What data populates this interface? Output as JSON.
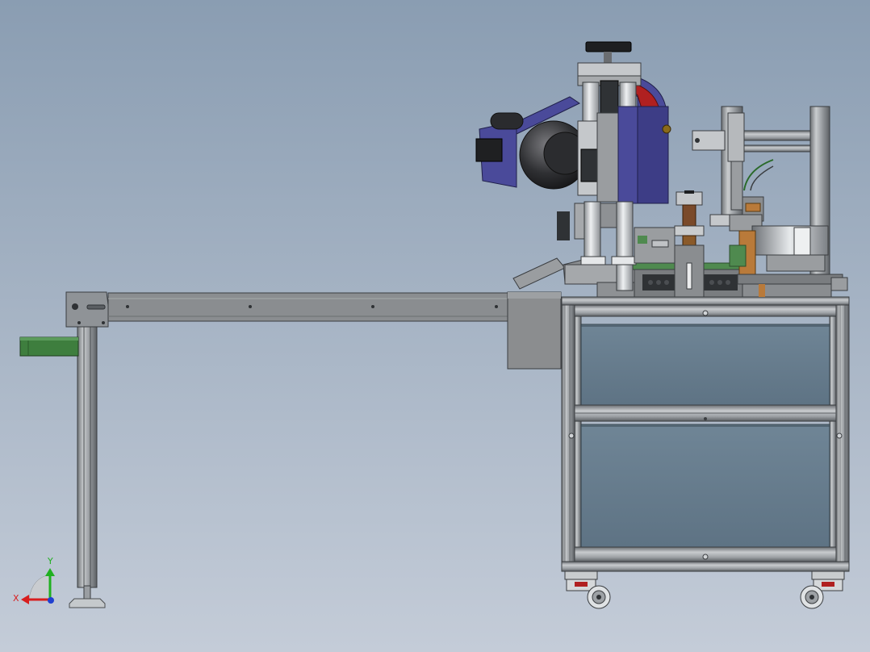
{
  "viewport": {
    "background_top": "#8a9db2",
    "background_bottom": "#c4ccd8"
  },
  "triad": {
    "x_label": "X",
    "y_label": "Y",
    "x_color": "#d81e1e",
    "y_color": "#20b020",
    "z_color": "#2040d0"
  },
  "model": {
    "frame_color": "#a8acb0",
    "panel_color": "#647b8c",
    "motor_color": "#4a4a9a",
    "pulley_color": "#b02020",
    "conveyor_color": "#8a8d90",
    "green_part_color": "#3e7e3e"
  }
}
